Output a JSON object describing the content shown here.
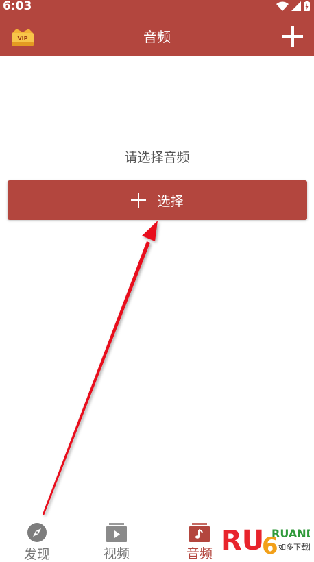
{
  "status_bar": {
    "time": "6:03"
  },
  "header": {
    "title": "音频",
    "vip_badge": "VIP",
    "add_icon": "plus-icon"
  },
  "main": {
    "prompt": "请选择音频",
    "select_button_label": "选择",
    "select_icon": "plus-icon"
  },
  "bottom_nav": {
    "items": [
      {
        "label": "发现",
        "icon": "compass-icon",
        "active": false
      },
      {
        "label": "视频",
        "icon": "video-icon",
        "active": false
      },
      {
        "label": "音频",
        "icon": "music-icon",
        "active": true
      }
    ]
  },
  "watermark": {
    "brand": "RUANDAO",
    "subtitle": "如多下载网"
  },
  "colors": {
    "accent": "#b3463e",
    "annotation_arrow": "#e8101b"
  }
}
